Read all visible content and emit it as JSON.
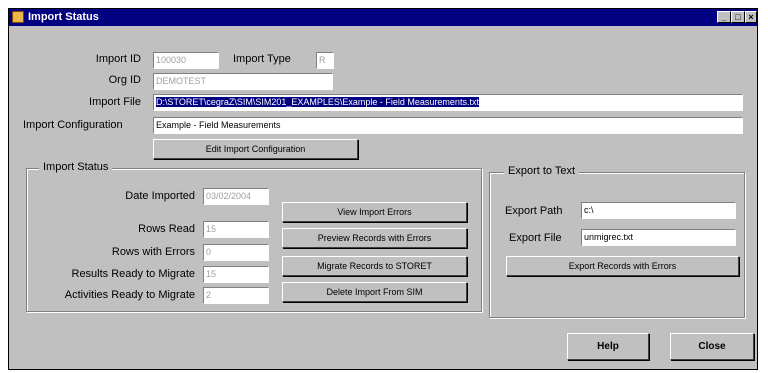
{
  "window": {
    "title": "Import Status"
  },
  "import": {
    "id_label": "Import ID",
    "id_value": "100030",
    "type_label": "Import Type",
    "type_value": "R",
    "org_label": "Org ID",
    "org_value": "DEMOTEST",
    "file_label": "Import File",
    "file_value": "D:\\STORET\\cegraZ\\SIM\\SIM201_EXAMPLES\\Example - Field Measurements.txt",
    "config_label": "Import Configuration",
    "config_value": "Example - Field Measurements",
    "edit_config_button": "Edit Import Configuration"
  },
  "status": {
    "legend": "Import Status",
    "date_label": "Date Imported",
    "date_value": "03/02/2004",
    "rows_read_label": "Rows Read",
    "rows_read_value": "15",
    "rows_errors_label": "Rows with Errors",
    "rows_errors_value": "0",
    "results_label": "Results Ready to Migrate",
    "results_value": "15",
    "activities_label": "Activities Ready to Migrate",
    "activities_value": "2",
    "view_errors_button": "View Import Errors",
    "preview_button": "Preview Records with Errors",
    "migrate_button": "Migrate Records to STORET",
    "delete_button": "Delete Import From SIM"
  },
  "export": {
    "legend": "Export to Text",
    "path_label": "Export Path",
    "path_value": "c:\\",
    "file_label": "Export File",
    "file_value": "unmigrec.txt",
    "export_button": "Export Records with Errors"
  },
  "footer": {
    "help_button": "Help",
    "close_button": "Close"
  }
}
